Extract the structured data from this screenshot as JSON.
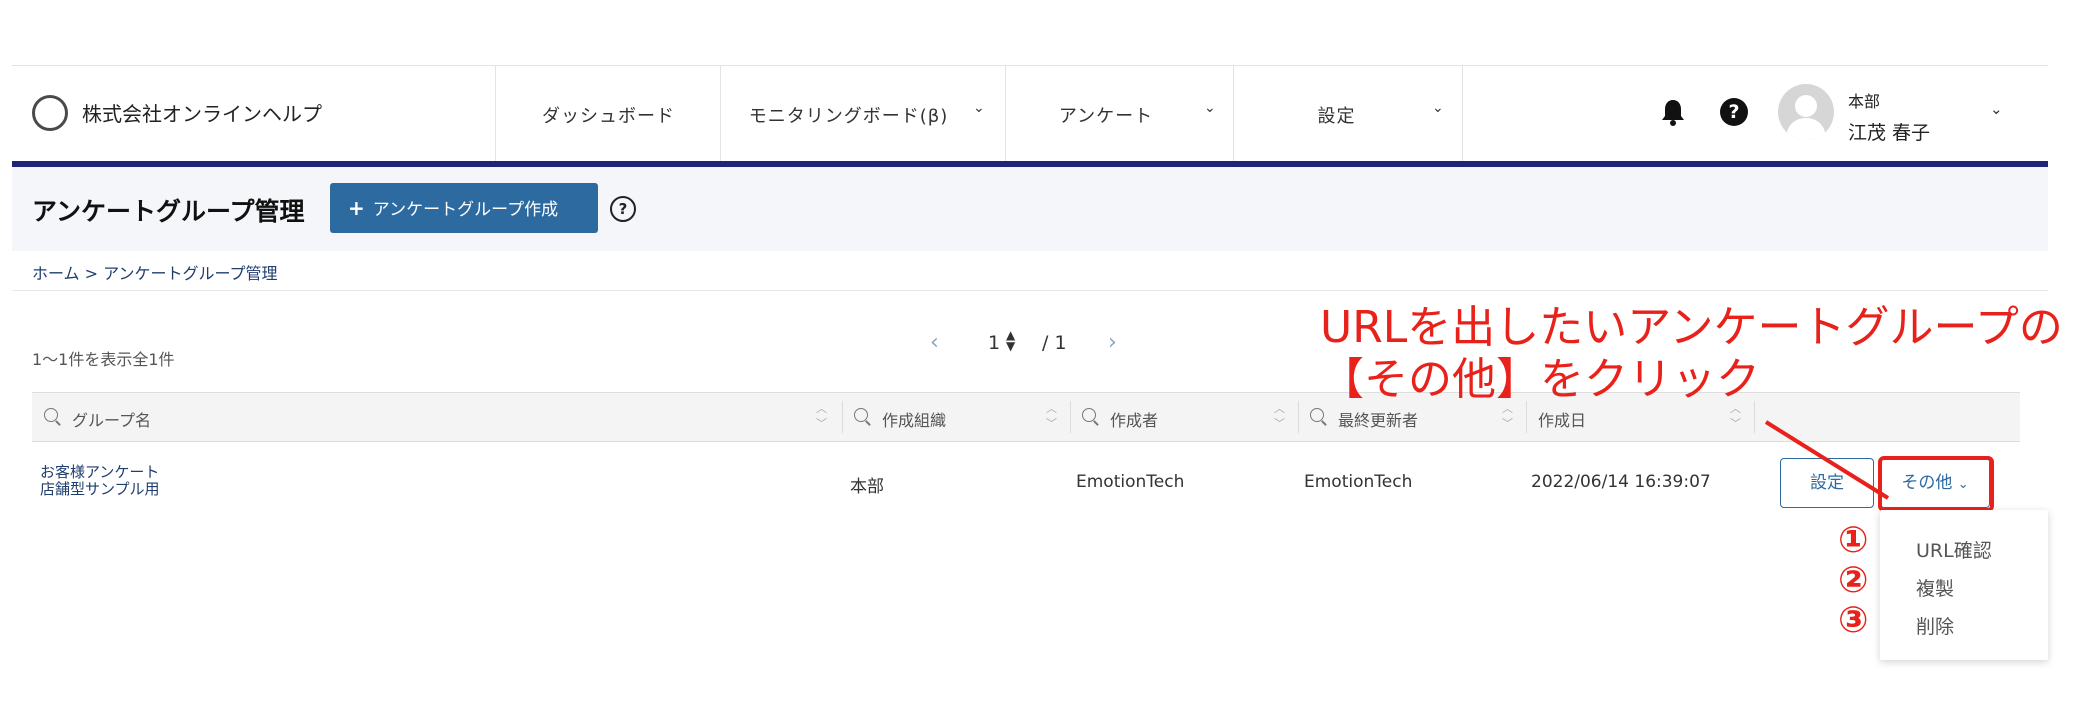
{
  "header": {
    "company_name": "株式会社オンラインヘルプ",
    "nav": [
      {
        "label": "ダッシュボード",
        "has_chevron": false
      },
      {
        "label": "モニタリングボード(β)",
        "has_chevron": true
      },
      {
        "label": "アンケート",
        "has_chevron": true
      },
      {
        "label": "設定",
        "has_chevron": true
      }
    ],
    "user_dept": "本部",
    "user_name": "江茂 春子",
    "accent_color": "#1e2478"
  },
  "page": {
    "title": "アンケートグループ管理",
    "create_button": "アンケートグループ作成",
    "help_label": "?",
    "breadcrumb_home": "ホーム",
    "breadcrumb_sep": " > ",
    "breadcrumb_current": "アンケートグループ管理"
  },
  "listing": {
    "count_text": "1〜1件を表示全1件",
    "pager_current": "1",
    "pager_total": "/ 1"
  },
  "table": {
    "columns": [
      "グループ名",
      "作成組織",
      "作成者",
      "最終更新者",
      "作成日"
    ],
    "rows": [
      {
        "name_line1": "お客様アンケート",
        "name_line2": "店舗型サンプル用",
        "org": "本部",
        "creator": "EmotionTech",
        "updater": "EmotionTech",
        "created": "2022/06/14 16:39:07",
        "settings_label": "設定",
        "other_label": "その他"
      }
    ]
  },
  "dropdown": {
    "items": [
      "URL確認",
      "複製",
      "削除"
    ],
    "numbers": [
      "①",
      "②",
      "③"
    ]
  },
  "annotation": {
    "line1": "URLを出したいアンケートグループの",
    "line2": "【その他】をクリック",
    "color": "#e8221b"
  }
}
